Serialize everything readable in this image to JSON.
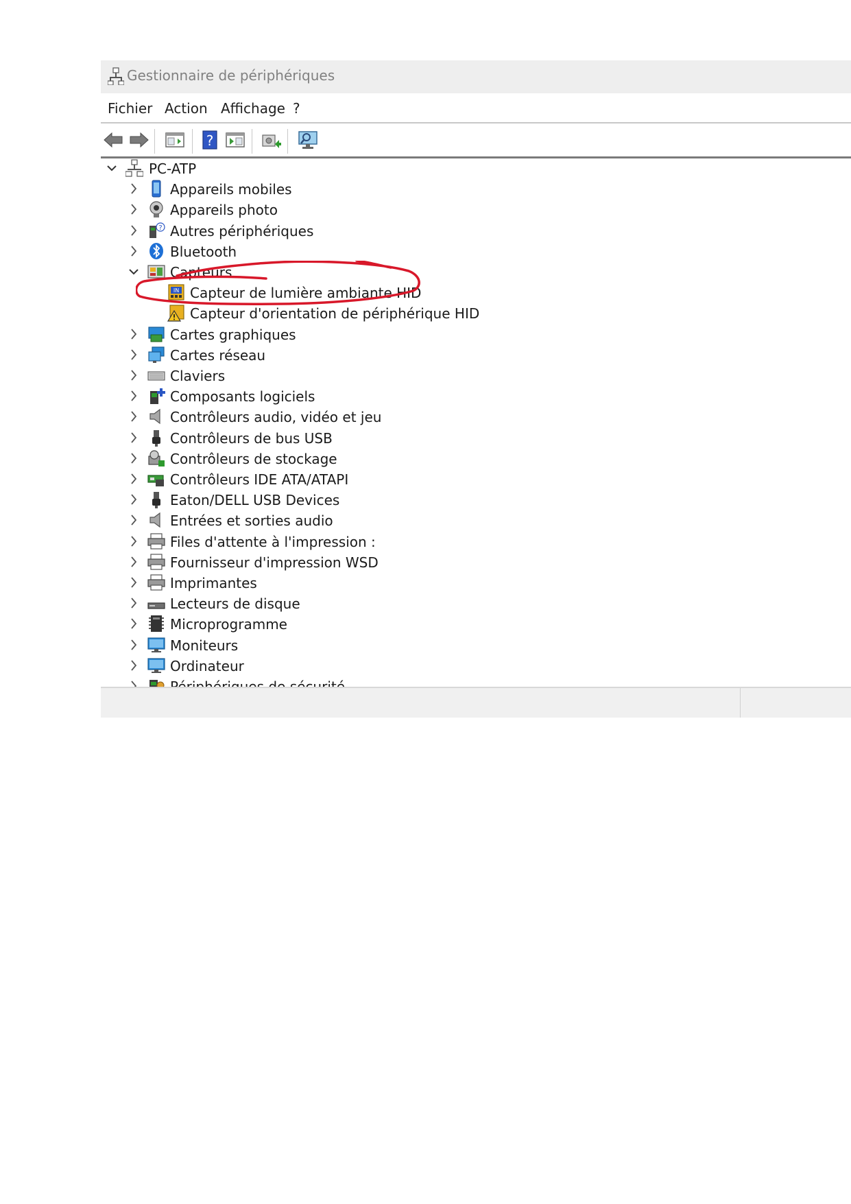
{
  "window": {
    "title": "Gestionnaire de périphériques",
    "title_icon": "device-manager-icon"
  },
  "menu": [
    "Fichier",
    "Action",
    "Affichage",
    "?"
  ],
  "toolbar": [
    "back-arrow-icon",
    "forward-arrow-icon",
    "properties-pane-icon",
    "help-icon",
    "show-hidden-pane-icon",
    "update-driver-icon",
    "scan-hardware-icon"
  ],
  "tree": {
    "root": "PC-ATP",
    "items": [
      {
        "label": "Appareils mobiles",
        "icon": "mobile-device-icon",
        "expanded": false
      },
      {
        "label": "Appareils photo",
        "icon": "camera-icon",
        "expanded": false
      },
      {
        "label": "Autres périphériques",
        "icon": "unknown-device-icon",
        "expanded": false
      },
      {
        "label": "Bluetooth",
        "icon": "bluetooth-icon",
        "expanded": false
      },
      {
        "label": "Capteurs",
        "icon": "sensor-icon",
        "expanded": true
      },
      {
        "label": "Capteur de lumière ambiante HID",
        "icon": "light-sensor-icon",
        "child": true
      },
      {
        "label": "Capteur d'orientation de périphérique HID",
        "icon": "warning-sensor-icon",
        "child": true
      },
      {
        "label": "Cartes graphiques",
        "icon": "display-adapter-icon",
        "expanded": false
      },
      {
        "label": "Cartes réseau",
        "icon": "network-adapter-icon",
        "expanded": false
      },
      {
        "label": "Claviers",
        "icon": "keyboard-icon",
        "expanded": false
      },
      {
        "label": "Composants logiciels",
        "icon": "software-component-icon",
        "expanded": false
      },
      {
        "label": "Contrôleurs audio, vidéo et jeu",
        "icon": "speaker-icon",
        "expanded": false
      },
      {
        "label": "Contrôleurs de bus USB",
        "icon": "usb-icon",
        "expanded": false
      },
      {
        "label": "Contrôleurs de stockage",
        "icon": "storage-controller-icon",
        "expanded": false
      },
      {
        "label": "Contrôleurs IDE ATA/ATAPI",
        "icon": "ide-controller-icon",
        "expanded": false
      },
      {
        "label": "Eaton/DELL USB Devices",
        "icon": "usb-icon",
        "expanded": false
      },
      {
        "label": "Entrées et sorties audio",
        "icon": "speaker-icon",
        "expanded": false
      },
      {
        "label": "Files d'attente à l'impression :",
        "icon": "printer-icon",
        "expanded": false
      },
      {
        "label": "Fournisseur d'impression WSD",
        "icon": "printer-icon",
        "expanded": false
      },
      {
        "label": "Imprimantes",
        "icon": "printer-icon",
        "expanded": false
      },
      {
        "label": "Lecteurs de disque",
        "icon": "disk-drive-icon",
        "expanded": false
      },
      {
        "label": "Microprogramme",
        "icon": "firmware-icon",
        "expanded": false
      },
      {
        "label": "Moniteurs",
        "icon": "monitor-icon",
        "expanded": false
      },
      {
        "label": "Ordinateur",
        "icon": "computer-icon",
        "expanded": false
      },
      {
        "label": "Périphériques de sécurité",
        "icon": "security-device-icon",
        "expanded": false
      }
    ]
  },
  "annotation": {
    "color": "#d8182a",
    "target": "Capteur de lumière ambiante HID"
  }
}
